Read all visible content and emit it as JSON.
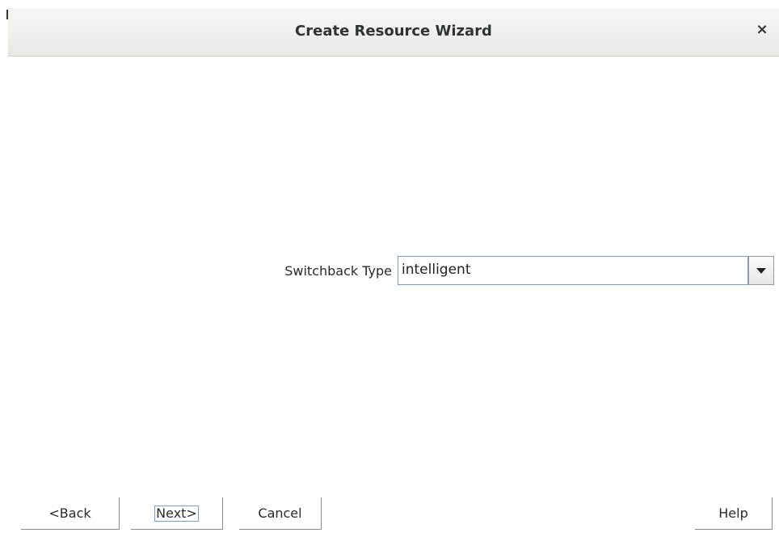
{
  "window": {
    "title": "Create Resource Wizard",
    "close_glyph": "×"
  },
  "form": {
    "switchback_label": "Switchback Type",
    "switchback_value": "intelligent"
  },
  "buttons": {
    "back": "<Back",
    "next": "Next>",
    "cancel": "Cancel",
    "help": "Help"
  },
  "icons": {
    "close": "close-icon",
    "dropdown": "chevron-down-icon"
  },
  "colors": {
    "focus_border": "#7a9cc8",
    "titlebar": "#ecebe9"
  }
}
